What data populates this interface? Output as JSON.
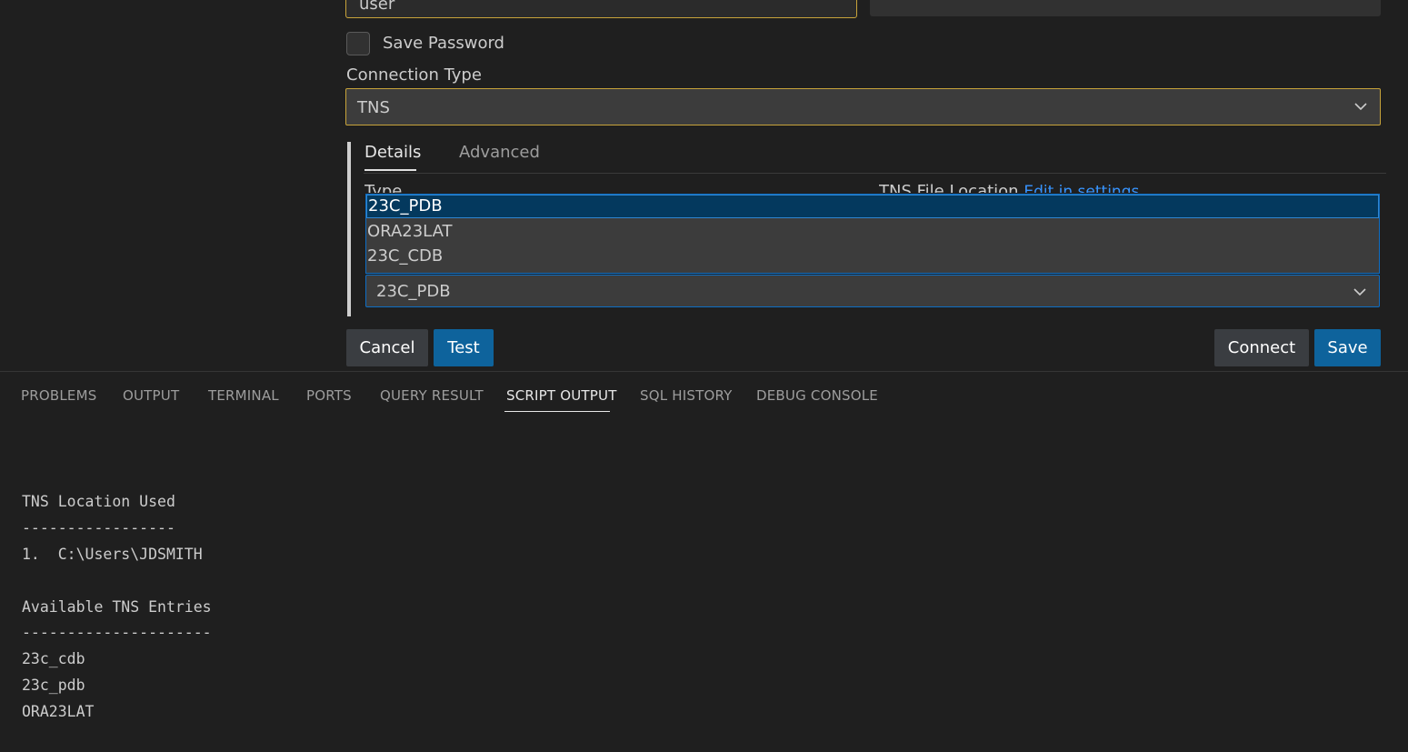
{
  "form": {
    "user_value": "user",
    "save_password_label": "Save Password",
    "connection_type_label": "Connection Type",
    "connection_type_value": "TNS",
    "accent_color": "#c7a33a"
  },
  "details": {
    "tabs": [
      {
        "label": "Details",
        "active": true
      },
      {
        "label": "Advanced",
        "active": false
      }
    ],
    "type_label": "Type",
    "tns_file_location_label": "TNS File Location",
    "edit_in_settings_link": "Edit in settings",
    "dropdown_options": [
      "23C_PDB",
      "ORA23LAT",
      "23C_CDB"
    ],
    "selected_option": "23C_PDB"
  },
  "actions": {
    "cancel": "Cancel",
    "test": "Test",
    "connect": "Connect",
    "save": "Save"
  },
  "panel": {
    "tabs": [
      "PROBLEMS",
      "OUTPUT",
      "TERMINAL",
      "PORTS",
      "QUERY RESULT",
      "SCRIPT OUTPUT",
      "SQL HISTORY",
      "DEBUG CONSOLE"
    ],
    "active_tab": "SCRIPT OUTPUT",
    "output_lines": [
      "TNS Location Used",
      "-----------------",
      "1.  C:\\Users\\JDSMITH",
      "",
      "Available TNS Entries",
      "---------------------",
      "23c_cdb",
      "23c_pdb",
      "ORA23LAT"
    ]
  },
  "icons": {
    "dropdown_chevron": "chevron-down-icon"
  }
}
